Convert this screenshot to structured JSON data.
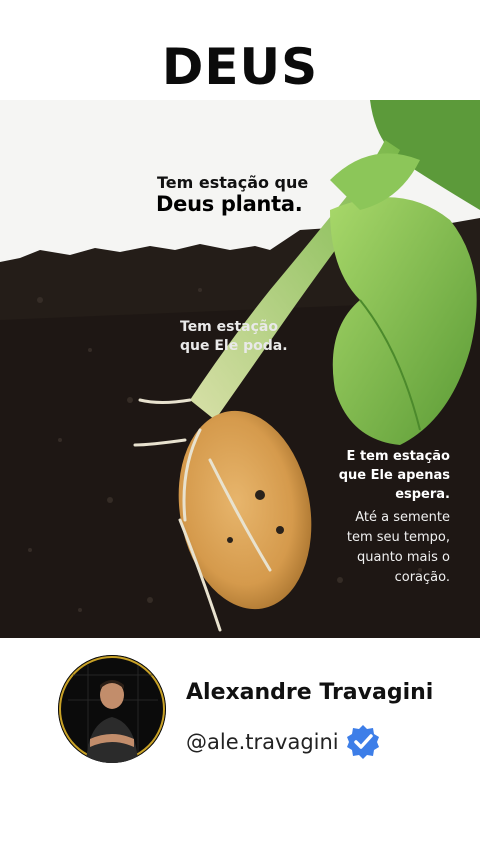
{
  "title": "DEUS",
  "quote": {
    "line1": "Tem estação que",
    "line2": "Deus planta.",
    "mid_line1": "Tem estação",
    "mid_line2": "que Ele poda.",
    "right_line1": "E tem estação",
    "right_line2": "que Ele apenas",
    "right_line3": "espera.",
    "tail_line1": "Até a semente",
    "tail_line2": "tem seu tempo,",
    "tail_line3": "quanto mais o",
    "tail_line4": "coração."
  },
  "profile": {
    "name": "Alexandre Travagini",
    "handle": "@ale.travagini",
    "verified_icon": "verified-badge-icon"
  },
  "colors": {
    "soil": "#1f1915",
    "leaf": "#78b84a",
    "seed": "#d9a35a",
    "verified": "#3d7ee8"
  }
}
